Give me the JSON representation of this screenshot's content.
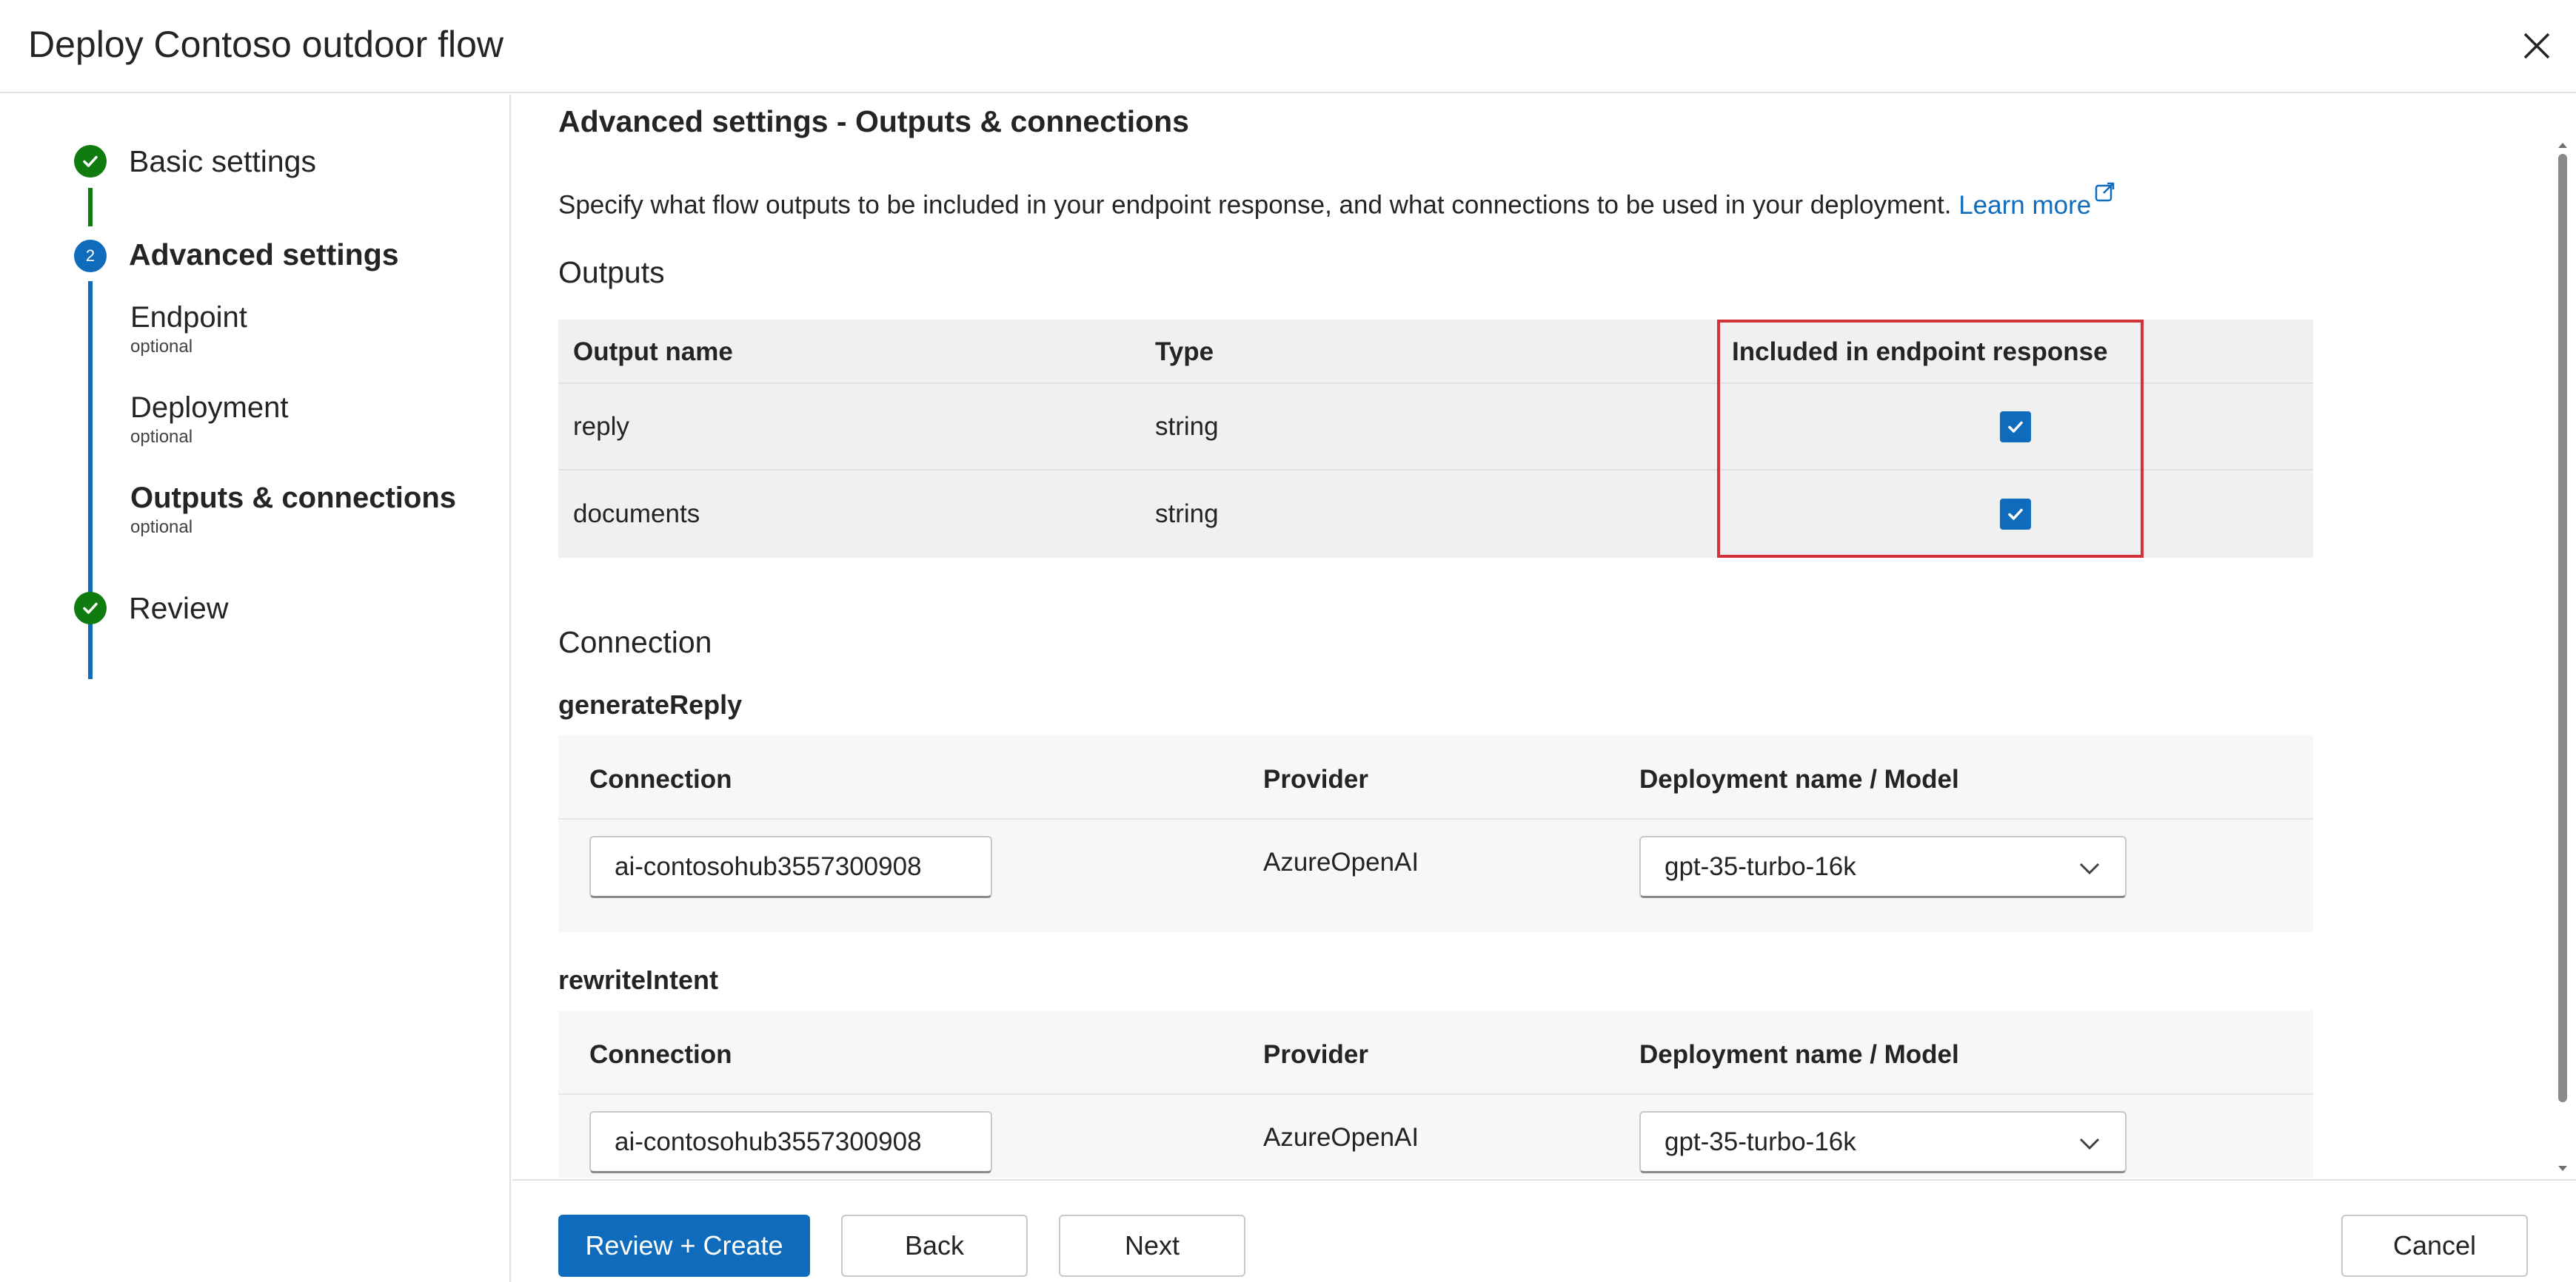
{
  "dialog": {
    "title": "Deploy Contoso outdoor flow",
    "close_icon": "close-icon"
  },
  "steps": {
    "basic": "Basic settings",
    "advanced_number": "2",
    "advanced": "Advanced settings",
    "endpoint": "Endpoint",
    "endpoint_optional": "optional",
    "deployment": "Deployment",
    "deployment_optional": "optional",
    "outputs": "Outputs & connections",
    "outputs_optional": "optional",
    "review": "Review"
  },
  "main": {
    "section_title": "Advanced settings - Outputs & connections",
    "description": "Specify what flow outputs to be included in your endpoint response, and what connections to be used in your deployment. ",
    "learn_more": "Learn more",
    "outputs_heading": "Outputs",
    "outputs_table": {
      "headers": [
        "Output name",
        "Type",
        "Included in endpoint response"
      ],
      "rows": [
        {
          "name": "reply",
          "type": "string",
          "included": true
        },
        {
          "name": "documents",
          "type": "string",
          "included": true
        }
      ]
    },
    "connection_heading": "Connection",
    "connections": [
      {
        "node": "generateReply",
        "headers": [
          "Connection",
          "Provider",
          "Deployment name / Model"
        ],
        "connection": "ai-contosohub3557300908",
        "provider": "AzureOpenAI",
        "model": "gpt-35-turbo-16k"
      },
      {
        "node": "rewriteIntent",
        "headers": [
          "Connection",
          "Provider",
          "Deployment name / Model"
        ],
        "connection": "ai-contosohub3557300908",
        "provider": "AzureOpenAI",
        "model": "gpt-35-turbo-16k"
      }
    ]
  },
  "footer": {
    "review_create": "Review + Create",
    "back": "Back",
    "next": "Next",
    "cancel": "Cancel"
  },
  "colors": {
    "accent": "#0f6cbd",
    "success": "#107c10",
    "highlight": "#d13438"
  }
}
